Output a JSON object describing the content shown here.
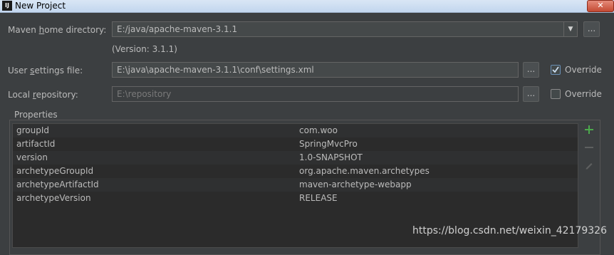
{
  "window": {
    "title": "New Project",
    "app_icon": "IJ"
  },
  "form": {
    "maven_home": {
      "label_pre": "Maven ",
      "label_mnemonic": "h",
      "label_post": "ome directory:",
      "value": "E:/java/apache-maven-3.1.1",
      "version_note": "(Version: 3.1.1)"
    },
    "user_settings": {
      "label_pre": "User ",
      "label_mnemonic": "s",
      "label_post": "ettings file:",
      "value": "E:\\java\\apache-maven-3.1.1\\conf\\settings.xml",
      "override_label": "Override",
      "override_checked": true
    },
    "local_repo": {
      "label_pre": "Local ",
      "label_mnemonic": "r",
      "label_post": "epository:",
      "value": "E:\\repository",
      "override_label": "Override",
      "override_checked": false
    },
    "browse_label": "..."
  },
  "properties": {
    "title": "Properties",
    "rows": [
      {
        "key": "groupId",
        "value": "com.woo"
      },
      {
        "key": "artifactId",
        "value": "SpringMvcPro"
      },
      {
        "key": "version",
        "value": "1.0-SNAPSHOT"
      },
      {
        "key": "archetypeGroupId",
        "value": "org.apache.maven.archetypes"
      },
      {
        "key": "archetypeArtifactId",
        "value": "maven-archetype-webapp"
      },
      {
        "key": "archetypeVersion",
        "value": "RELEASE"
      }
    ],
    "tools": [
      "add-icon",
      "remove-icon",
      "edit-icon"
    ]
  },
  "watermark": "https://blog.csdn.net/weixin_42179326",
  "colors": {
    "background": "#3c3f41",
    "table": "#2b2b2b",
    "add": "#4ca94c",
    "check": "#6a8fb5"
  }
}
